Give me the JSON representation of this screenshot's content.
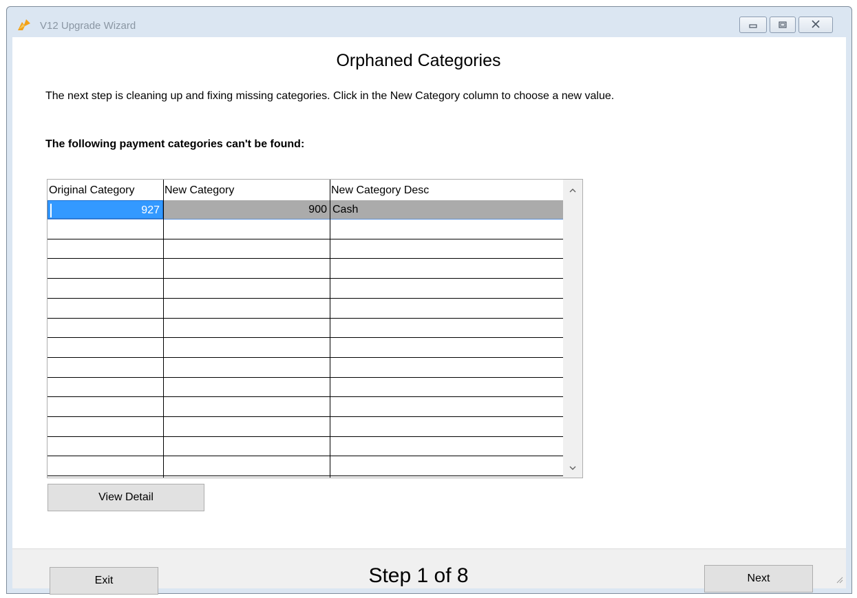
{
  "window": {
    "title": "V12 Upgrade Wizard",
    "controls": {
      "minimize": "minimize-icon",
      "maximize": "maximize-icon",
      "close": "close-icon"
    }
  },
  "page": {
    "heading": "Orphaned Categories",
    "instructions": "The next step is cleaning up and fixing missing categories.  Click in the New Category column to choose a new value.",
    "subheading": "The following payment categories can't be found:"
  },
  "grid": {
    "columns": [
      "Original Category",
      "New Category",
      "New Category Desc"
    ],
    "rows": [
      {
        "original": "927",
        "new": "900",
        "desc": "Cash"
      },
      {
        "original": "",
        "new": "",
        "desc": ""
      },
      {
        "original": "",
        "new": "",
        "desc": ""
      },
      {
        "original": "",
        "new": "",
        "desc": ""
      },
      {
        "original": "",
        "new": "",
        "desc": ""
      },
      {
        "original": "",
        "new": "",
        "desc": ""
      },
      {
        "original": "",
        "new": "",
        "desc": ""
      },
      {
        "original": "",
        "new": "",
        "desc": ""
      },
      {
        "original": "",
        "new": "",
        "desc": ""
      },
      {
        "original": "",
        "new": "",
        "desc": ""
      },
      {
        "original": "",
        "new": "",
        "desc": ""
      },
      {
        "original": "",
        "new": "",
        "desc": ""
      },
      {
        "original": "",
        "new": "",
        "desc": ""
      },
      {
        "original": "",
        "new": "",
        "desc": ""
      }
    ]
  },
  "buttons": {
    "view_detail": "View Detail",
    "exit": "Exit",
    "next": "Next"
  },
  "footer": {
    "step": "Step 1 of 8"
  },
  "colors": {
    "selection": "#3399ff",
    "selected_row_gray": "#ababab",
    "footer_bg": "#f0f0f0"
  }
}
